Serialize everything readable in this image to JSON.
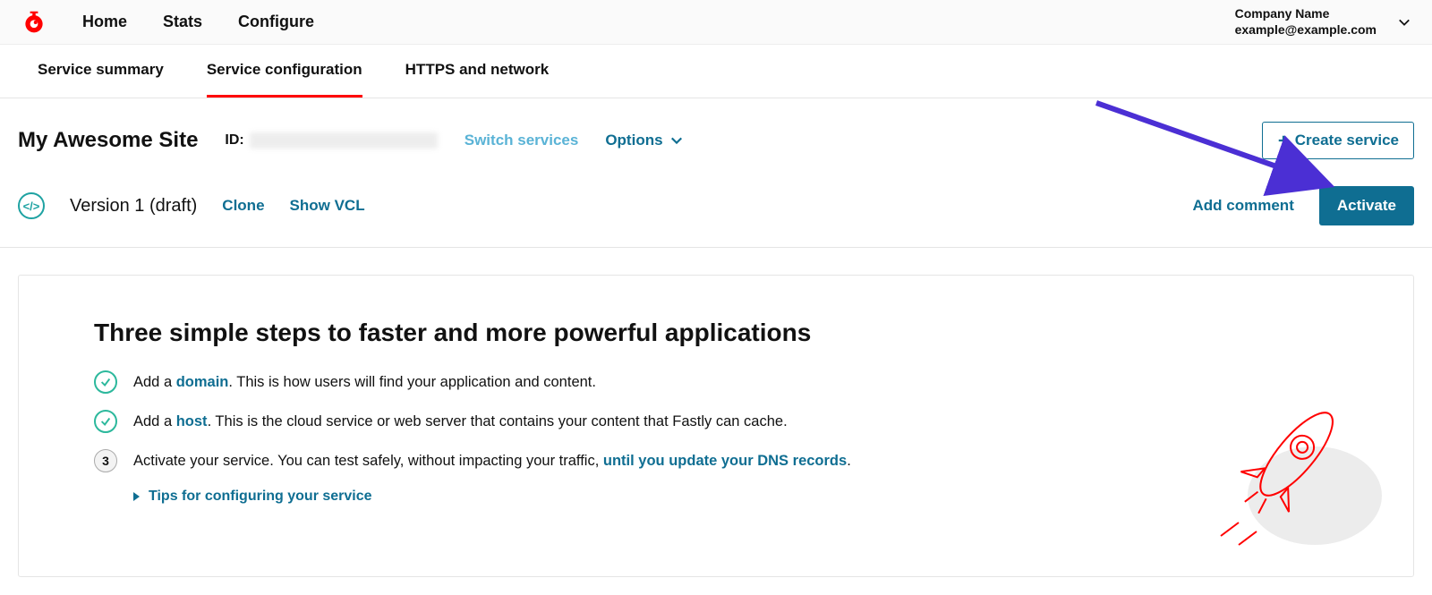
{
  "nav": {
    "items": [
      "Home",
      "Stats",
      "Configure"
    ],
    "account": {
      "company": "Company Name",
      "email": "example@example.com"
    }
  },
  "subtabs": {
    "items": [
      "Service summary",
      "Service configuration",
      "HTTPS and network"
    ],
    "active_index": 1
  },
  "service": {
    "name": "My Awesome Site",
    "id_label": "ID:",
    "switch_label": "Switch services",
    "options_label": "Options",
    "create_label": "Create service"
  },
  "version": {
    "label": "Version 1 (draft)",
    "clone_label": "Clone",
    "show_vcl_label": "Show VCL",
    "add_comment_label": "Add comment",
    "activate_label": "Activate"
  },
  "panel": {
    "title": "Three simple steps to faster and more powerful applications",
    "step1": {
      "prefix": "Add a ",
      "link": "domain",
      "suffix": ". This is how users will find your application and content."
    },
    "step2": {
      "prefix": "Add a ",
      "link": "host",
      "suffix": ". This is the cloud service or web server that contains your content that Fastly can cache."
    },
    "step3": {
      "num": "3",
      "prefix": "Activate your service. You can test safely, without impacting your traffic, ",
      "link": "until you update your DNS records",
      "suffix": "."
    },
    "tips_label": "Tips for configuring your service"
  },
  "colors": {
    "brand_red": "#ff0000",
    "link_blue": "#0f6e92",
    "teal": "#2cb89c",
    "arrow_purple": "#4b2fd4"
  }
}
